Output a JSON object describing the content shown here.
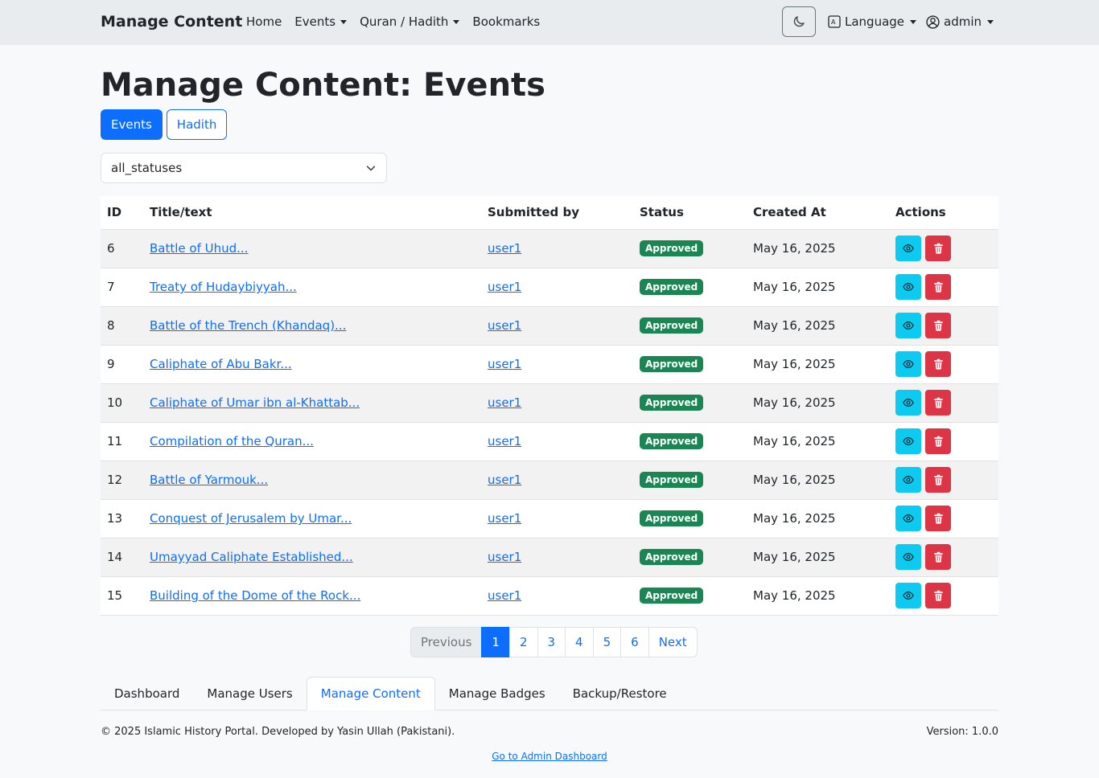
{
  "nav": {
    "brand": "Manage Content",
    "items": [
      {
        "label": "Home",
        "dropdown": false
      },
      {
        "label": "Events",
        "dropdown": true
      },
      {
        "label": "Quran / Hadith",
        "dropdown": true
      },
      {
        "label": "Bookmarks",
        "dropdown": false
      }
    ],
    "language": "Language",
    "user": "admin",
    "theme_icon": "moon-icon"
  },
  "page": {
    "title": "Manage Content: Events",
    "tabs": [
      "Events",
      "Hadith"
    ],
    "status_filter": "all_statuses"
  },
  "table": {
    "headers": [
      "ID",
      "Title/text",
      "Submitted by",
      "Status",
      "Created At",
      "Actions"
    ],
    "rows": [
      {
        "id": "6",
        "title": "Battle of Uhud...",
        "by": "user1",
        "status": "Approved",
        "created": "May 16, 2025"
      },
      {
        "id": "7",
        "title": "Treaty of Hudaybiyyah...",
        "by": "user1",
        "status": "Approved",
        "created": "May 16, 2025"
      },
      {
        "id": "8",
        "title": "Battle of the Trench (Khandaq)...",
        "by": "user1",
        "status": "Approved",
        "created": "May 16, 2025"
      },
      {
        "id": "9",
        "title": "Caliphate of Abu Bakr...",
        "by": "user1",
        "status": "Approved",
        "created": "May 16, 2025"
      },
      {
        "id": "10",
        "title": "Caliphate of Umar ibn al-Khattab...",
        "by": "user1",
        "status": "Approved",
        "created": "May 16, 2025"
      },
      {
        "id": "11",
        "title": "Compilation of the Quran...",
        "by": "user1",
        "status": "Approved",
        "created": "May 16, 2025"
      },
      {
        "id": "12",
        "title": "Battle of Yarmouk...",
        "by": "user1",
        "status": "Approved",
        "created": "May 16, 2025"
      },
      {
        "id": "13",
        "title": "Conquest of Jerusalem by Umar...",
        "by": "user1",
        "status": "Approved",
        "created": "May 16, 2025"
      },
      {
        "id": "14",
        "title": "Umayyad Caliphate Established...",
        "by": "user1",
        "status": "Approved",
        "created": "May 16, 2025"
      },
      {
        "id": "15",
        "title": "Building of the Dome of the Rock...",
        "by": "user1",
        "status": "Approved",
        "created": "May 16, 2025"
      }
    ]
  },
  "pagination": {
    "previous": "Previous",
    "pages": [
      "1",
      "2",
      "3",
      "4",
      "5",
      "6"
    ],
    "active": "1",
    "next": "Next"
  },
  "admin_tabs": {
    "items": [
      "Dashboard",
      "Manage Users",
      "Manage Content",
      "Manage Badges",
      "Backup/Restore"
    ],
    "active": "Manage Content"
  },
  "footer": {
    "copyright": "© 2025 Islamic History Portal. Developed by Yasin Ullah (Pakistani).",
    "version": "Version: 1.0.0",
    "link": "Go to Admin Dashboard"
  },
  "colors": {
    "primary": "#0d6efd",
    "success": "#198754",
    "info": "#0dcaf0",
    "danger": "#dc3545"
  }
}
